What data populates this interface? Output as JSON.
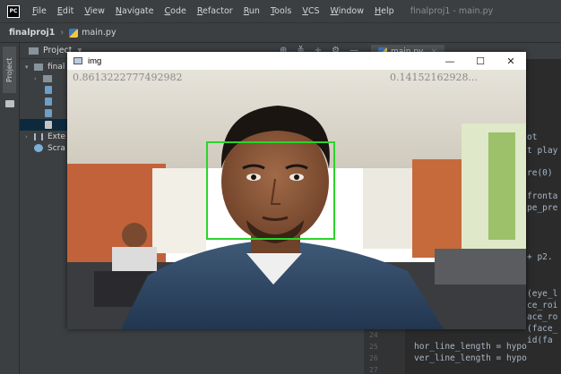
{
  "ide": {
    "logo": "PC",
    "menu": [
      "File",
      "Edit",
      "View",
      "Navigate",
      "Code",
      "Refactor",
      "Run",
      "Tools",
      "VCS",
      "Window",
      "Help"
    ],
    "window_title": "finalproj1 - main.py",
    "breadcrumb": {
      "project": "finalproj1",
      "file": "main.py"
    },
    "project_pane": {
      "title": "Project",
      "tree": [
        {
          "label": "final",
          "kind": "folder",
          "expanded": true
        },
        {
          "label": "",
          "kind": "folder"
        },
        {
          "label": "",
          "kind": "file"
        },
        {
          "label": "",
          "kind": "file"
        },
        {
          "label": "",
          "kind": "file"
        },
        {
          "label": "",
          "kind": "file",
          "selected": true
        },
        {
          "label": "Exte",
          "kind": "library"
        },
        {
          "label": "Scra",
          "kind": "scratch"
        }
      ]
    },
    "side_tab_label": "Project",
    "editor_tab": "main.py",
    "code_fragments": [
      "ot",
      "t play",
      "re(0)",
      "fronta",
      "pe_pre",
      "+ p2.",
      "(eye_l",
      "ce_roi",
      "ace_ro",
      "(face_",
      "id(fa"
    ],
    "gutter_numbers": [
      "24",
      "25",
      "26",
      "27"
    ],
    "code_lines": [
      "hor_line_length = hypo",
      "ver_line_length = hypo"
    ]
  },
  "img_window": {
    "title": "img",
    "controls": [
      "—",
      "☐",
      "✕"
    ],
    "readout_left": "0.8613222777492982",
    "readout_right": "0.14152162928..."
  },
  "colors": {
    "face_box": "#2bd42b",
    "ide_bg": "#2b2b2b",
    "panel_bg": "#3c3f41"
  }
}
